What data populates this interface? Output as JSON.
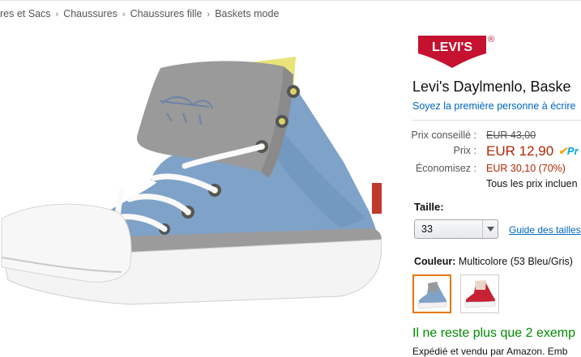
{
  "breadcrumb": {
    "items": [
      "res et Sacs",
      "Chaussures",
      "Chaussures fille",
      "Baskets mode"
    ],
    "separator": "›"
  },
  "brand": {
    "logo_text": "LEVI'S",
    "registered": "®",
    "logo_color": "#c41230"
  },
  "product": {
    "title": "Levi's Daylmenlo, Baske",
    "review_link": "Soyez la première personne à écrire"
  },
  "pricing": {
    "list_label": "Prix conseillé :",
    "list_price": "EUR 43,00",
    "price_label": "Prix :",
    "price": "EUR 12,90",
    "prime_label": "Pr",
    "savings_label": "Économisez :",
    "savings": "EUR 30,10 (70%)",
    "tax_note": "Tous les prix incluen"
  },
  "size": {
    "label": "Taille:",
    "selected": "33",
    "guide_link": "Guide des tailles"
  },
  "color": {
    "label": "Couleur:",
    "value": "Multicolore (53 Bleu/Gris)"
  },
  "availability": {
    "stock": "Il ne reste plus que 2 exemp",
    "shipping": "Expédié et vendu par Amazon. Emb"
  },
  "colors": {
    "link": "#0066c0",
    "price_red": "#b12704",
    "in_stock_green": "#008a00",
    "selected_border": "#e77600",
    "prime_blue": "#00a8e1"
  }
}
